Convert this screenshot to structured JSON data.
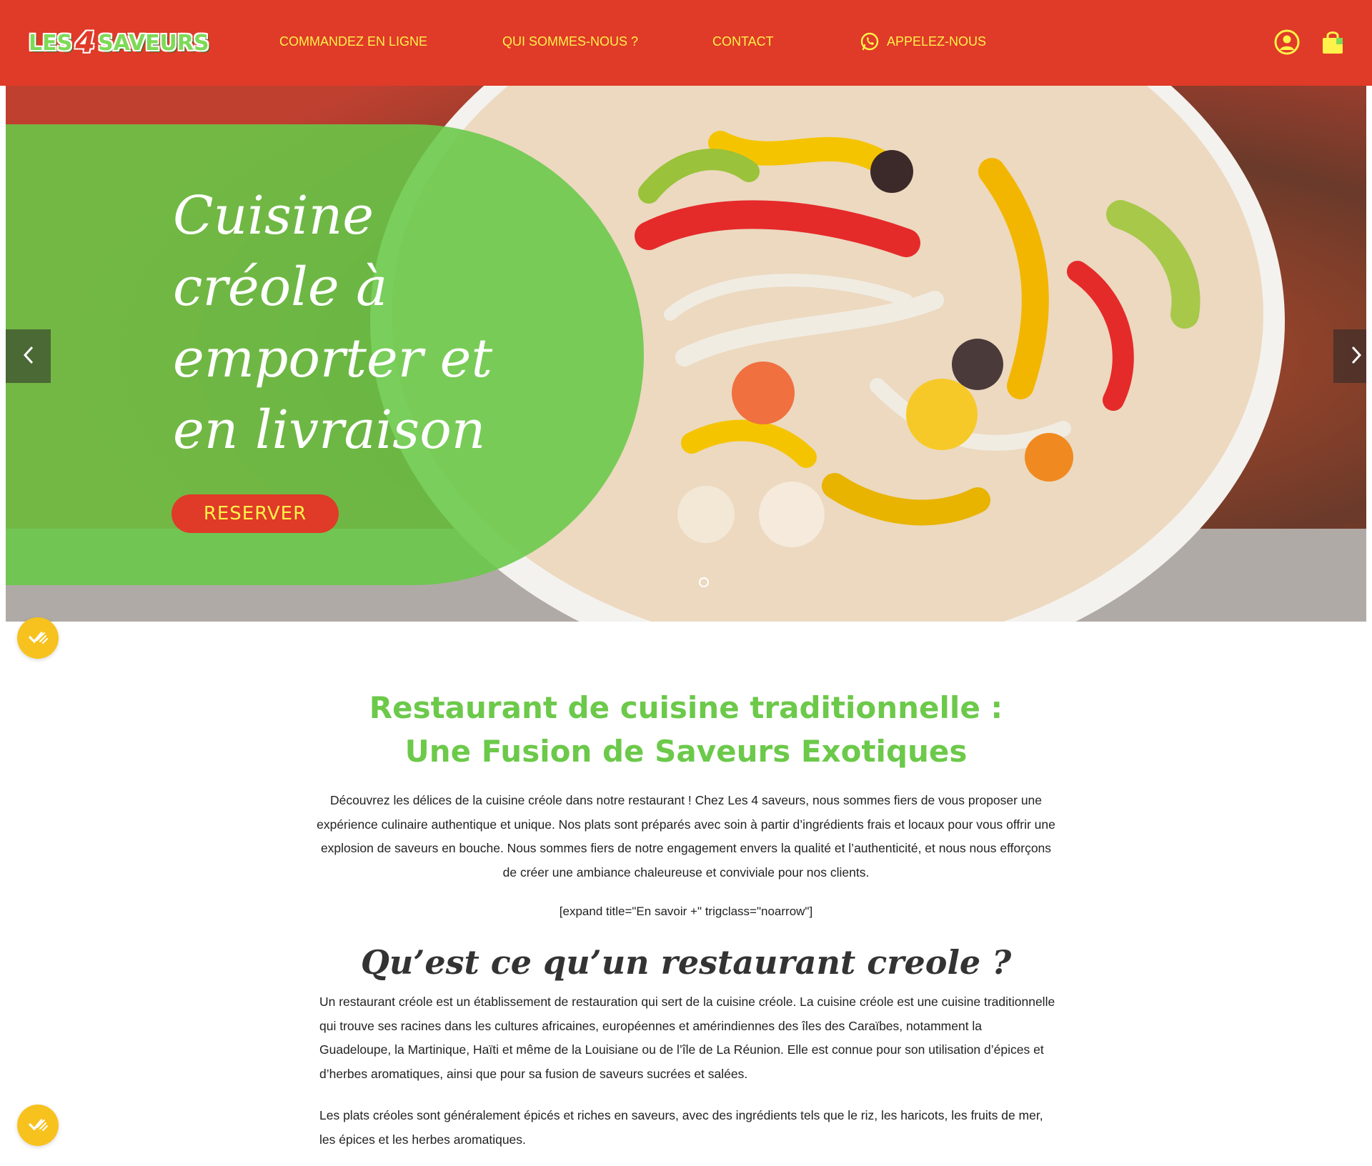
{
  "header": {
    "logo_left": "LES",
    "logo_four": "4",
    "logo_right": "SAVEURS",
    "nav": {
      "order": "COMMANDEZ EN LIGNE",
      "about": "QUI SOMMES-NOUS ?",
      "contact": "CONTACT",
      "call": "APPELEZ-NOUS"
    },
    "icons": {
      "account": "user-circle-icon",
      "cart": "shopping-bag-icon",
      "call": "whatsapp-icon"
    }
  },
  "hero": {
    "title": "Cuisine créole à emporter et en livraison",
    "button": "RESERVER",
    "icons": {
      "prev": "chevron-left-icon",
      "next": "chevron-right-icon"
    }
  },
  "content": {
    "title_line1": "Restaurant de cuisine traditionnelle :",
    "title_line2": "Une Fusion de Saveurs Exotiques",
    "intro": "Découvrez les délices de la cuisine créole dans notre restaurant ! Chez Les 4 saveurs, nous sommes fiers de vous proposer une expérience culinaire authentique et unique. Nos plats sont préparés avec soin à partir d’ingrédients frais et locaux pour vous offrir une explosion de saveurs en bouche. Nous sommes fiers de notre engagement envers la qualité et l’authenticité, et nous nous efforçons de créer une ambiance chaleureuse et conviviale pour nos clients.",
    "shortcode": "[expand title=\"En savoir +\" trigclass=\"noarrow\"]",
    "h2": "Qu’est ce qu’un restaurant creole ?",
    "para1": "Un restaurant créole est un établissement de restauration qui sert de la cuisine créole. La cuisine créole est une cuisine traditionnelle qui trouve ses racines dans les cultures africaines, européennes et amérindiennes des îles des Caraïbes, notamment la Guadeloupe, la Martinique, Haïti et même de la Louisiane ou de l’île de La Réunion. Elle est connue pour son utilisation d’épices et d’herbes aromatiques, ainsi que pour sa fusion de saveurs sucrées et salées.",
    "para2": "Les plats créoles sont généralement épicés et riches en saveurs, avec des ingrédients tels que le riz, les haricots, les fruits de mer, les épices et les herbes aromatiques."
  },
  "colors": {
    "header_bg": "#e03a28",
    "nav_text": "#fff24a",
    "accent_green": "#6cc94a",
    "badge_yellow": "#f7c21e"
  },
  "badges": {
    "icon": "check-badge-icon"
  }
}
